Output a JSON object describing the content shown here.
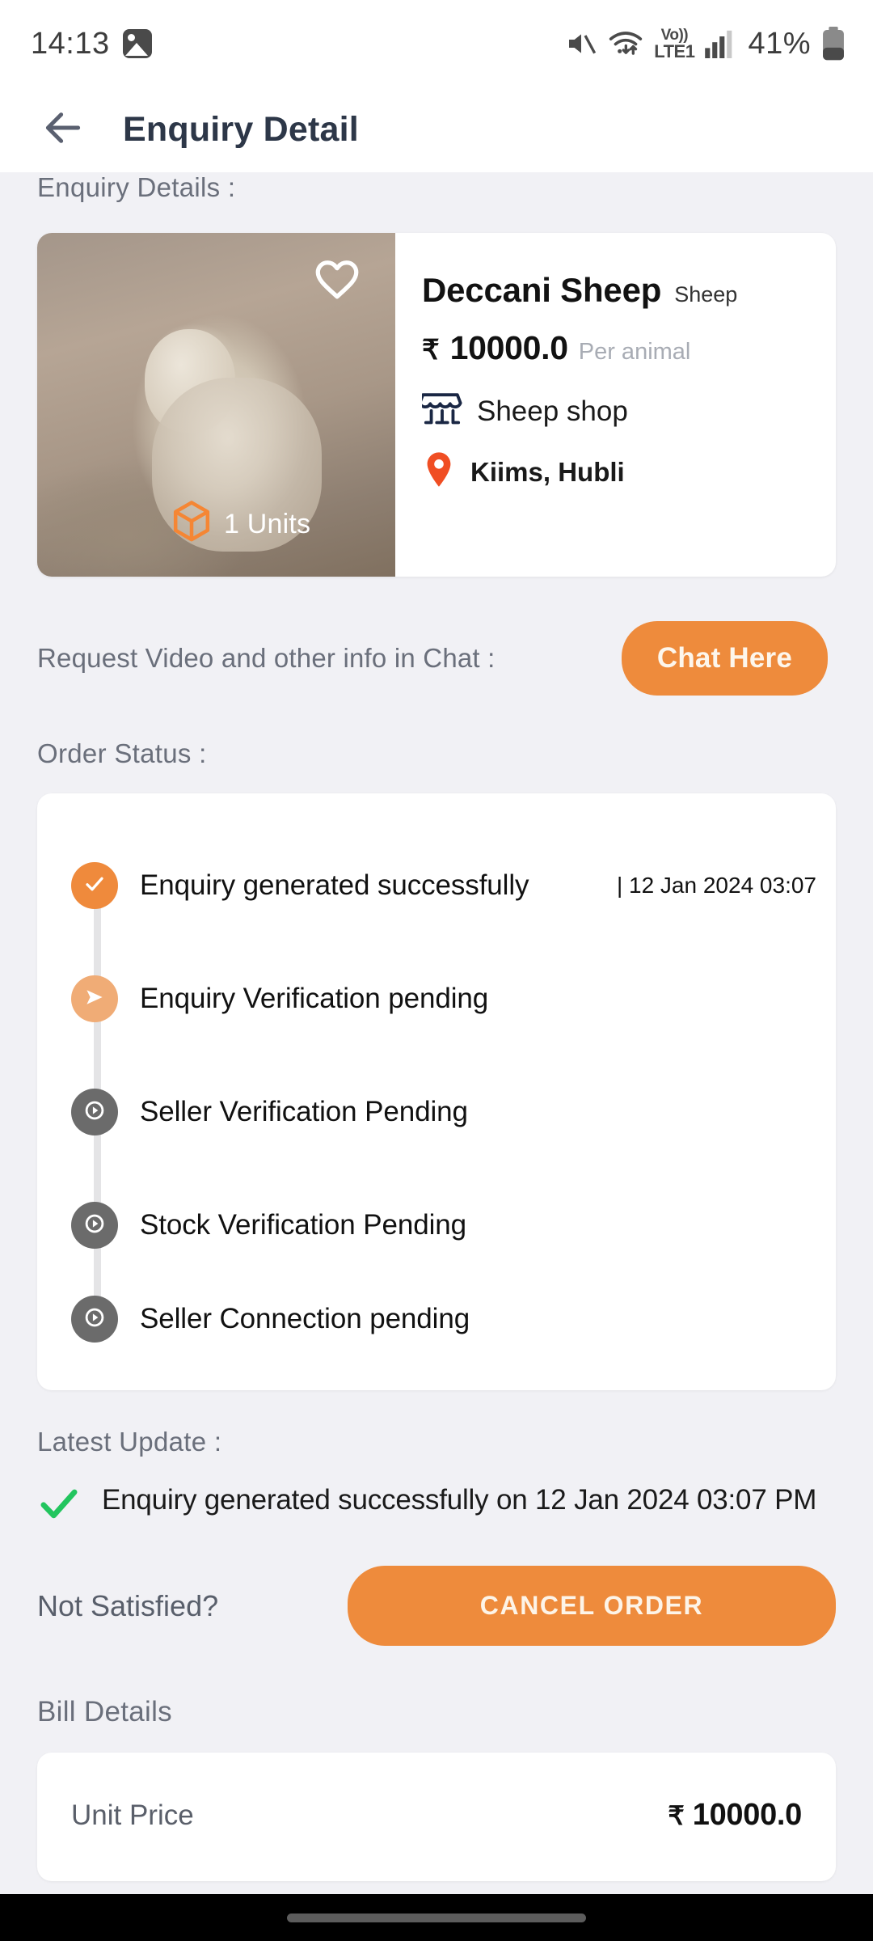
{
  "status_bar": {
    "time": "14:13",
    "gallery_icon": "gallery-icon",
    "mute_icon": "speaker-muted-icon",
    "wifi_icon": "wifi-data-icon",
    "volte_top": "Vo))",
    "volte_bottom": "LTE1",
    "signal_icon": "cellular-signal-icon",
    "battery_percent": "41%",
    "battery_icon": "battery-icon"
  },
  "app_bar": {
    "back_icon": "back-arrow-icon",
    "title": "Enquiry Detail"
  },
  "enquiry": {
    "section_label": "Enquiry Details :",
    "favorite_icon": "heart-outline-icon",
    "units_icon": "cube-icon",
    "units_text": "1 Units",
    "name": "Deccani Sheep",
    "category": "Sheep",
    "currency": "₹",
    "price": "10000.0",
    "price_unit": "Per animal",
    "shop_icon": "storefront-icon",
    "shop_name": "Sheep shop",
    "location_icon": "location-pin-icon",
    "location": "Kiims, Hubli"
  },
  "chat": {
    "label": "Request Video and other info in Chat :",
    "button": "Chat Here"
  },
  "order_status": {
    "section_label": "Order Status :",
    "steps": [
      {
        "label": "Enquiry generated successfully",
        "time": "| 12 Jan 2024 03:07",
        "state": "done",
        "icon": "check-icon"
      },
      {
        "label": "Enquiry Verification pending",
        "time": "",
        "state": "active",
        "icon": "send-arrow-icon"
      },
      {
        "label": "Seller Verification Pending",
        "time": "",
        "state": "pending",
        "icon": "clock-play-icon"
      },
      {
        "label": "Stock Verification Pending",
        "time": "",
        "state": "pending",
        "icon": "clock-play-icon"
      },
      {
        "label": "Seller Connection pending",
        "time": "",
        "state": "pending",
        "icon": "clock-play-icon"
      }
    ]
  },
  "latest_update": {
    "section_label": "Latest Update :",
    "check_icon": "green-check-icon",
    "text": "Enquiry generated successfully on 12 Jan 2024 03:07 PM"
  },
  "cancel": {
    "prompt": "Not Satisfied?",
    "button": "CANCEL ORDER"
  },
  "bill": {
    "section_label": "Bill Details",
    "rows": [
      {
        "key": "Unit Price",
        "currency": "₹",
        "value": "10000.0"
      }
    ]
  },
  "colors": {
    "accent_orange": "#ee8b3c",
    "node_active": "#f0ac76",
    "node_pending": "#6b6b6b",
    "shop_navy": "#1a2744",
    "pin_orange": "#f04e23",
    "green_check": "#22c55e",
    "page_bg": "#f1f1f5"
  }
}
